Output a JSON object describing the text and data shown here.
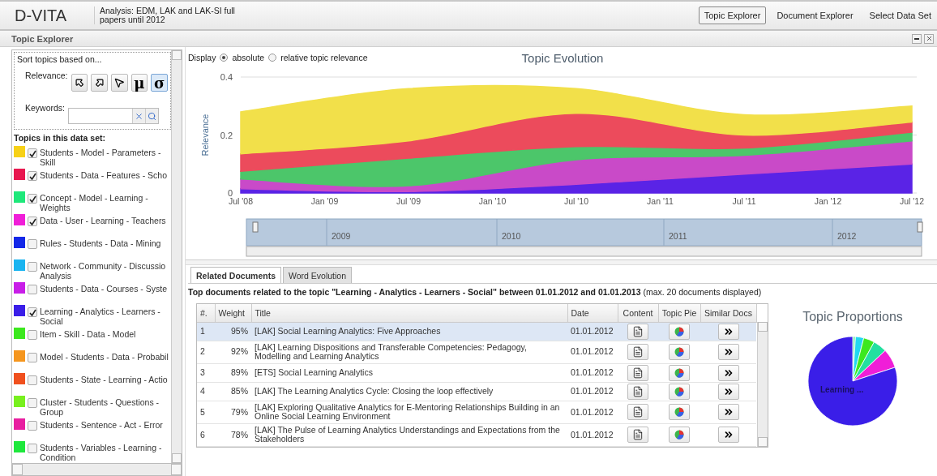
{
  "app": {
    "logo": "D-VITA",
    "analysis": "Analysis: EDM, LAK and LAK-SI full papers until 2012"
  },
  "nav": [
    {
      "label": "Topic Explorer",
      "selected": true
    },
    {
      "label": "Document Explorer",
      "selected": false
    },
    {
      "label": "Select Data Set",
      "selected": false
    }
  ],
  "panel": {
    "title": "Topic Explorer"
  },
  "sort": {
    "heading": "Sort topics based on...",
    "relevance_label": "Relevance:",
    "keywords_label": "Keywords:",
    "buttons": [
      {
        "kind": "icon",
        "selected": false
      },
      {
        "kind": "icon",
        "selected": false
      },
      {
        "kind": "icon",
        "selected": false
      },
      {
        "kind": "symbol",
        "label": "μ",
        "selected": false
      },
      {
        "kind": "symbol",
        "label": "σ",
        "selected": true
      }
    ]
  },
  "topics_heading": "Topics in this data set:",
  "topics": [
    {
      "label": "Students - Model - Parameters - Skill",
      "color": "#f7d117",
      "checked": true
    },
    {
      "label": "Students - Data - Features - Scho",
      "color": "#e8174f",
      "checked": true
    },
    {
      "label": "Concept - Model - Learning - Weights",
      "color": "#1ee87a",
      "checked": true
    },
    {
      "label": "Data - User - Learning - Teachers",
      "color": "#f01ed8",
      "checked": true
    },
    {
      "label": "Rules - Students - Data - Mining",
      "color": "#1428e8",
      "checked": false
    },
    {
      "label": "Network - Community - Discussio Analysis",
      "color": "#1ab4f0",
      "checked": false
    },
    {
      "label": "Students - Data - Courses - Syste",
      "color": "#c81ee8",
      "checked": false
    },
    {
      "label": "Learning - Analytics - Learners - Social",
      "color": "#3a1ee8",
      "checked": true
    },
    {
      "label": "Item - Skill - Data - Model",
      "color": "#3ce81e",
      "checked": false
    },
    {
      "label": "Model - Students - Data - Probabil",
      "color": "#f5961e",
      "checked": false
    },
    {
      "label": "Students - State - Learning - Actio",
      "color": "#f0501e",
      "checked": false
    },
    {
      "label": "Cluster - Students - Questions - Group",
      "color": "#78f01e",
      "checked": false
    },
    {
      "label": "Students - Sentence - Act - Error",
      "color": "#e81ea0",
      "checked": false
    },
    {
      "label": "Students - Variables - Learning - Condition",
      "color": "#1ee83c",
      "checked": false
    }
  ],
  "display": {
    "label": "Display",
    "options": [
      {
        "label": "absolute",
        "selected": true
      },
      {
        "label": "relative topic relevance",
        "selected": false
      }
    ]
  },
  "evolution": {
    "chart_data": {
      "type": "area",
      "title": "Topic Evolution",
      "ylabel": "Relevance",
      "stacked": true,
      "categories": [
        "Jul '08",
        "Jan '09",
        "Jul '09",
        "Jan '10",
        "Jul '10",
        "Jan '11",
        "Jul '11",
        "Jan '12",
        "Jul '12"
      ],
      "ylim": [
        0,
        0.4
      ],
      "yticks": [
        0,
        0.2,
        0.4
      ],
      "series": [
        {
          "color": "#5a23e6",
          "values": [
            0.015,
            null,
            0.005,
            null,
            0.03,
            null,
            0.065,
            null,
            0.1
          ]
        },
        {
          "color": "#c94ac8",
          "values": [
            0.033,
            null,
            0.02,
            null,
            0.085,
            null,
            0.065,
            null,
            0.08
          ]
        },
        {
          "color": "#4cc66a",
          "values": [
            0.027,
            null,
            0.095,
            null,
            0.045,
            null,
            0.025,
            null,
            0.03
          ]
        },
        {
          "color": "#ec4b5c",
          "values": [
            0.06,
            null,
            0.06,
            null,
            0.115,
            null,
            0.045,
            null,
            0.035
          ]
        },
        {
          "color": "#f2e04a",
          "values": [
            0.145,
            null,
            0.18,
            null,
            0.085,
            null,
            0.07,
            null,
            0.055
          ]
        }
      ]
    },
    "navigator_years": [
      "2009",
      "2010",
      "2011",
      "2012"
    ]
  },
  "tabs": [
    {
      "label": "Related Documents",
      "selected": true
    },
    {
      "label": "Word Evolution",
      "selected": false
    }
  ],
  "documents_heading": "**Top documents related to the topic \"Learning - Analytics - Learners - Social\" between 01.01.2012 and 01.01.2013** (max. 20 documents displayed)",
  "table": {
    "columns": [
      "#.",
      "Weight",
      "Title",
      "Date",
      "Content",
      "Topic Pie",
      "Similar Docs"
    ],
    "rows": [
      {
        "num": "1",
        "weight": "95%",
        "title": "[LAK] Social Learning Analytics: Five Approaches",
        "date": "01.01.2012",
        "selected": true
      },
      {
        "num": "2",
        "weight": "92%",
        "title": "[LAK] Learning Dispositions and Transferable Competencies: Pedagogy, Modelling and Learning Analytics",
        "date": "01.01.2012",
        "selected": false
      },
      {
        "num": "3",
        "weight": "89%",
        "title": "[ETS] Social Learning Analytics",
        "date": "01.01.2012",
        "selected": false
      },
      {
        "num": "4",
        "weight": "85%",
        "title": "[LAK] The Learning Analytics Cycle: Closing the loop effectively",
        "date": "01.01.2012",
        "selected": false
      },
      {
        "num": "5",
        "weight": "79%",
        "title": "[LAK] Exploring Qualitative Analytics for E-Mentoring Relationships Building in an Online Social Learning Environment",
        "date": "01.01.2012",
        "selected": false
      },
      {
        "num": "6",
        "weight": "78%",
        "title": "[LAK] The Pulse of Learning Analytics Understandings and Expectations from the Stakeholders",
        "date": "01.01.2012",
        "selected": false
      }
    ]
  },
  "proportions": {
    "title": "Topic Proportions",
    "slice_label": "Learning ..."
  }
}
